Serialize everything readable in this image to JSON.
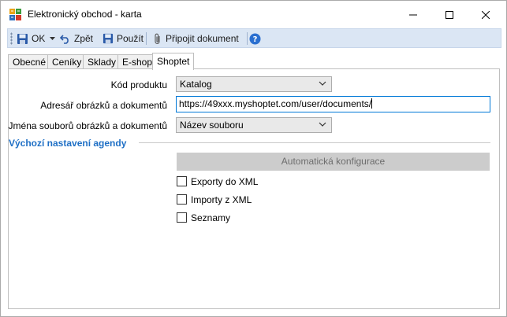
{
  "window": {
    "title": "Elektronický obchod - karta"
  },
  "toolbar": {
    "ok_label": "OK",
    "back_label": "Zpět",
    "apply_label": "Použít",
    "attach_label": "Připojit dokument"
  },
  "tabs": [
    {
      "label": "Obecné",
      "active": false
    },
    {
      "label": "Ceníky",
      "active": false
    },
    {
      "label": "Sklady",
      "active": false
    },
    {
      "label": "E-shop",
      "active": false
    },
    {
      "label": "Shoptet",
      "active": true
    }
  ],
  "form": {
    "product_code_label": "Kód produktu",
    "product_code_value": "Katalog",
    "dir_label": "Adresář obrázků a dokumentů",
    "dir_value": "https://49xxx.myshoptet.com/user/documents/",
    "filenames_label": "Jména souborů obrázků a dokumentů",
    "filenames_value": "Název souboru"
  },
  "section": {
    "title": "Výchozí nastavení agendy",
    "auto_config_label": "Automatická konfigurace",
    "checkboxes": [
      {
        "label": "Exporty do XML",
        "checked": false
      },
      {
        "label": "Importy z XML",
        "checked": false
      },
      {
        "label": "Seznamy",
        "checked": false
      }
    ]
  },
  "colors": {
    "accent": "#1e6fc5",
    "toolbar_bg": "#dbe6f4",
    "input_border_focus": "#0078d7"
  }
}
